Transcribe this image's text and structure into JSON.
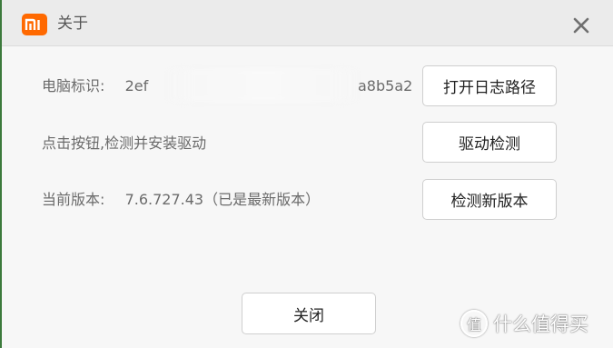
{
  "window": {
    "logo_text": "MI",
    "title": "关于",
    "close_glyph": "✕"
  },
  "rows": [
    {
      "label": "电脑标识:",
      "value_left": "2ef",
      "value_right": "a8b5a2",
      "button": "打开日志路径"
    },
    {
      "label": "点击按钮,检测并安装驱动",
      "value_left": "",
      "value_right": "",
      "button": "驱动检测"
    },
    {
      "label": "当前版本:",
      "value_left": "7.6.727.43（已是最新版本）",
      "value_right": "",
      "button": "检测新版本"
    }
  ],
  "footer": {
    "close_button": "关闭"
  },
  "watermark": {
    "icon_glyph": "值",
    "text": "什么值得买"
  },
  "colors": {
    "brand": "#ff6900",
    "text": "#6b6b6b",
    "titlebar": "#ebebeb"
  },
  "icons": {
    "logo": "xiaomi-logo-icon",
    "close": "close-icon",
    "watermark": "smzdm-logo-icon"
  }
}
